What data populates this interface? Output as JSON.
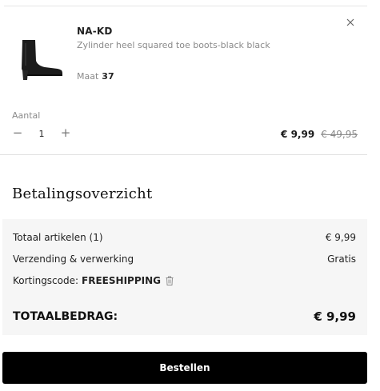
{
  "cart_item": {
    "brand": "NA-KD",
    "name": "Zylinder heel squared toe boots-black black",
    "size_label": "Maat",
    "size_value": "37",
    "quantity_label": "Aantal",
    "quantity": "1",
    "minus": "−",
    "plus": "+",
    "price": "€ 9,99",
    "old_price": "€ 49,95",
    "image_icon": "black-ankle-boot-image",
    "remove_icon": "close-icon"
  },
  "summary": {
    "title": "Betalingsoverzicht",
    "items_label": "Totaal artikelen (1)",
    "items_value": "€ 9,99",
    "shipping_label": "Verzending & verwerking",
    "shipping_value": "Gratis",
    "code_label": "Kortingscode:",
    "code_value": "FREESHIPPING",
    "code_icon": "trash-icon",
    "total_label": "TOTAALBEDRAG:",
    "total_value": "€ 9,99"
  },
  "order_button": "Bestellen",
  "colors": {
    "panel_bg": "#f6f6f6",
    "button_bg": "#000000",
    "muted_text": "#8a8a8a"
  }
}
